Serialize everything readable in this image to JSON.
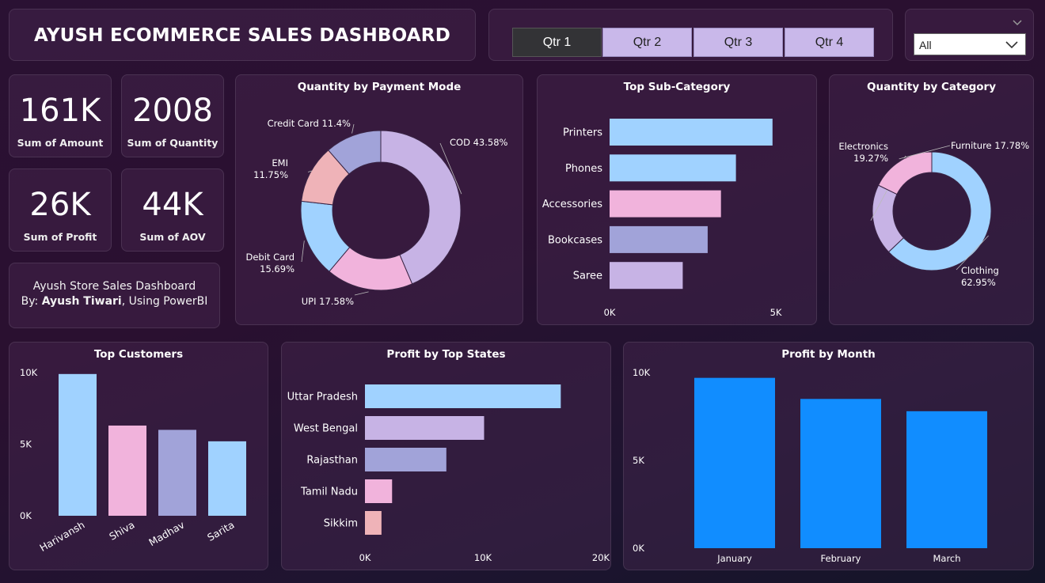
{
  "header": {
    "title": "AYUSH ECOMMERCE SALES DASHBOARD"
  },
  "quarter_slicer": {
    "buttons": [
      {
        "label": "Qtr 1",
        "selected": true
      },
      {
        "label": "Qtr 2",
        "selected": false
      },
      {
        "label": "Qtr 3",
        "selected": false
      },
      {
        "label": "Qtr 4",
        "selected": false
      }
    ]
  },
  "dropdown_slicer": {
    "value": "All"
  },
  "kpis": [
    {
      "value": "161K",
      "label": "Sum of Amount"
    },
    {
      "value": "2008",
      "label": "Sum of Quantity"
    },
    {
      "value": "26K",
      "label": "Sum of Profit"
    },
    {
      "value": "44K",
      "label": "Sum of AOV"
    }
  ],
  "note": {
    "line1": "Ayush Store Sales Dashboard",
    "by": "By: ",
    "author": "Ayush Tiwari",
    "tail": ", Using PowerBI"
  },
  "colors": {
    "lavender": "#c7b3e5",
    "pink": "#f1b3dc",
    "light_blue": "#a0d2ff",
    "periwinkle": "#a1a3d9",
    "rose": "#efb3b8",
    "blue": "#118dff"
  },
  "chart_data": [
    {
      "id": "payment",
      "type": "pie",
      "title": "Quantity by Payment Mode",
      "slices": [
        {
          "name": "COD",
          "value": 43.58,
          "label": "COD 43.58%",
          "color": "#c7b3e5"
        },
        {
          "name": "UPI",
          "value": 17.58,
          "label": "UPI 17.58%",
          "color": "#f1b3dc"
        },
        {
          "name": "Debit Card",
          "value": 15.69,
          "label": "Debit Card\n15.69%",
          "color": "#a0d2ff"
        },
        {
          "name": "EMI",
          "value": 11.75,
          "label": "EMI\n11.75%",
          "color": "#efb3b8"
        },
        {
          "name": "Credit Card",
          "value": 11.4,
          "label": "Credit Card 11.4%",
          "color": "#a1a3d9"
        }
      ]
    },
    {
      "id": "subcat",
      "type": "bar",
      "orientation": "horizontal",
      "title": "Top Sub-Category",
      "categories": [
        "Printers",
        "Phones",
        "Accessories",
        "Bookcases",
        "Saree"
      ],
      "values": [
        4900,
        3800,
        3350,
        2950,
        2200
      ],
      "colors": [
        "#a0d2ff",
        "#a0d2ff",
        "#f1b3dc",
        "#a1a3d9",
        "#c7b3e5"
      ],
      "xlim": [
        0,
        5000
      ],
      "ticks": [
        "0K",
        "5K"
      ]
    },
    {
      "id": "category",
      "type": "pie",
      "title": "Quantity by Category",
      "slices": [
        {
          "name": "Clothing",
          "value": 62.95,
          "label": "Clothing\n62.95%",
          "color": "#a0d2ff"
        },
        {
          "name": "Electronics",
          "value": 19.27,
          "label": "Electronics\n19.27%",
          "color": "#c7b3e5"
        },
        {
          "name": "Furniture",
          "value": 17.78,
          "label": "Furniture 17.78%",
          "color": "#f1b3dc"
        }
      ]
    },
    {
      "id": "customers",
      "type": "bar",
      "orientation": "vertical",
      "title": "Top Customers",
      "categories": [
        "Harivansh",
        "Shiva",
        "Madhav",
        "Sarita"
      ],
      "values": [
        9900,
        6300,
        6000,
        5200
      ],
      "colors": [
        "#a0d2ff",
        "#f1b3dc",
        "#a1a3d9",
        "#a0d2ff"
      ],
      "ylim": [
        0,
        10000
      ],
      "ticks": [
        "0K",
        "5K",
        "10K"
      ]
    },
    {
      "id": "states",
      "type": "bar",
      "orientation": "horizontal",
      "title": "Profit by Top States",
      "categories": [
        "Uttar Pradesh",
        "West Bengal",
        "Rajasthan",
        "Tamil Nadu",
        "Sikkim"
      ],
      "values": [
        16600,
        10100,
        6900,
        2300,
        1400
      ],
      "colors": [
        "#a0d2ff",
        "#c7b3e5",
        "#a1a3d9",
        "#f1b3dc",
        "#efb3b8"
      ],
      "xlim": [
        0,
        20000
      ],
      "ticks": [
        "0K",
        "10K",
        "20K"
      ]
    },
    {
      "id": "months",
      "type": "bar",
      "orientation": "vertical",
      "title": "Profit by Month",
      "categories": [
        "January",
        "February",
        "March"
      ],
      "values": [
        9700,
        8500,
        7800
      ],
      "colors": [
        "#118dff",
        "#118dff",
        "#118dff"
      ],
      "ylim": [
        0,
        10000
      ],
      "ticks": [
        "0K",
        "5K",
        "10K"
      ]
    }
  ]
}
